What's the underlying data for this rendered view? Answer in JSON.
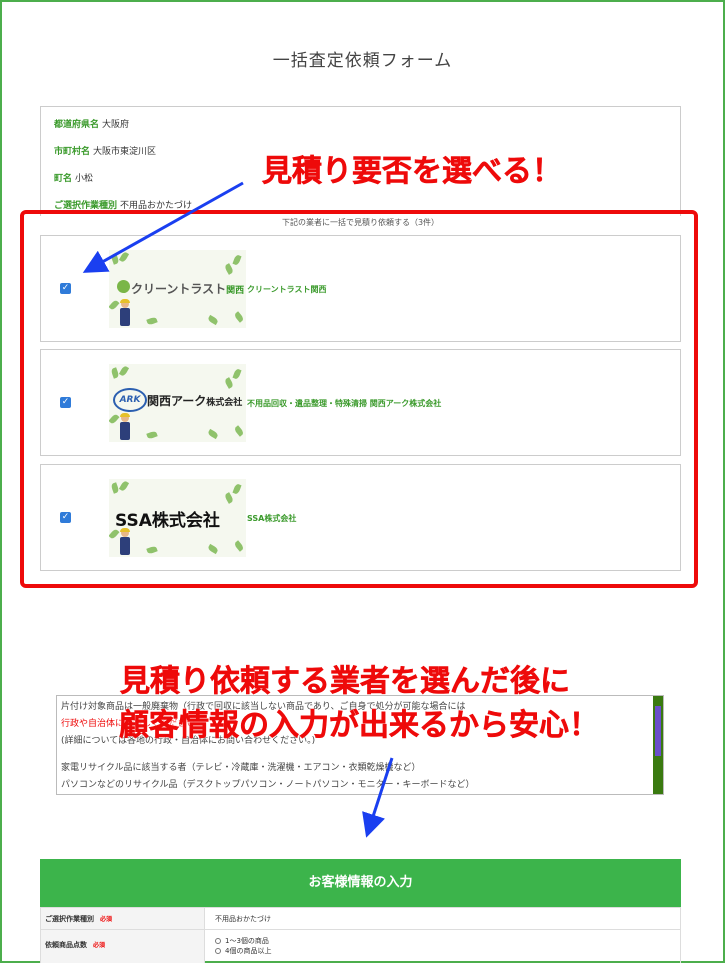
{
  "page": {
    "title": "一括査定依頼フォーム"
  },
  "info": {
    "rows": [
      {
        "label": "都道府県名",
        "value": "大阪府"
      },
      {
        "label": "市町村名",
        "value": "大阪市東淀川区"
      },
      {
        "label": "町名",
        "value": "小松"
      },
      {
        "label": "ご選択作業種別",
        "value": "不用品おかたづけ"
      }
    ]
  },
  "vendors": {
    "caption": "下記の業者に一括で見積り依頼する（3件）",
    "items": [
      {
        "checked": true,
        "logo_main": "クリーントラスト",
        "logo_accent": "関西",
        "name": "クリーントラスト関西"
      },
      {
        "checked": true,
        "logo_mark": "ARK",
        "logo_main": "関西アーク",
        "logo_small": "株式会社",
        "name": "不用品回収・遺品整理・特殊清掃 関西アーク株式会社"
      },
      {
        "checked": true,
        "logo_main": "SSA株式会社",
        "name": "SSA株式会社"
      }
    ]
  },
  "annotations": {
    "top": "見積り要否を選べる！",
    "middle_line1": "見積り依頼する業者を選んだ後に",
    "middle_line2": "顧客情報の入力が出来るから安心！",
    "color": "#ee0a0a",
    "arrow_color": "#1a3ff0"
  },
  "notice": {
    "line1": "片付け対象商品は一般廃棄物（行政で回収に該当しない商品であり、ご自身で処分が可能な場合には",
    "line2": "行政や自治体に依頼してください",
    "line3": "(詳細については各地の行政・自治体にお問い合わせください。)",
    "line4": "家電リサイクル品に該当する者（テレビ・冷蔵庫・洗濯機・エアコン・衣類乾燥機など）",
    "line5": "パソコンなどのリサイクル品（デスクトップパソコン・ノートパソコン・モニター・キーボードなど）"
  },
  "customer": {
    "header": "お客様情報の入力",
    "required_badge": "必須",
    "rows": [
      {
        "label": "ご選択作業種別",
        "value": "不用品おかたづけ"
      },
      {
        "label": "依頼商品点数",
        "options": [
          "1〜3個の商品",
          "4個の商品以上"
        ]
      }
    ]
  },
  "colors": {
    "brand_green": "#3cb44b",
    "label_green": "#3a9a2b",
    "checkbox_blue": "#2f7bd9"
  }
}
